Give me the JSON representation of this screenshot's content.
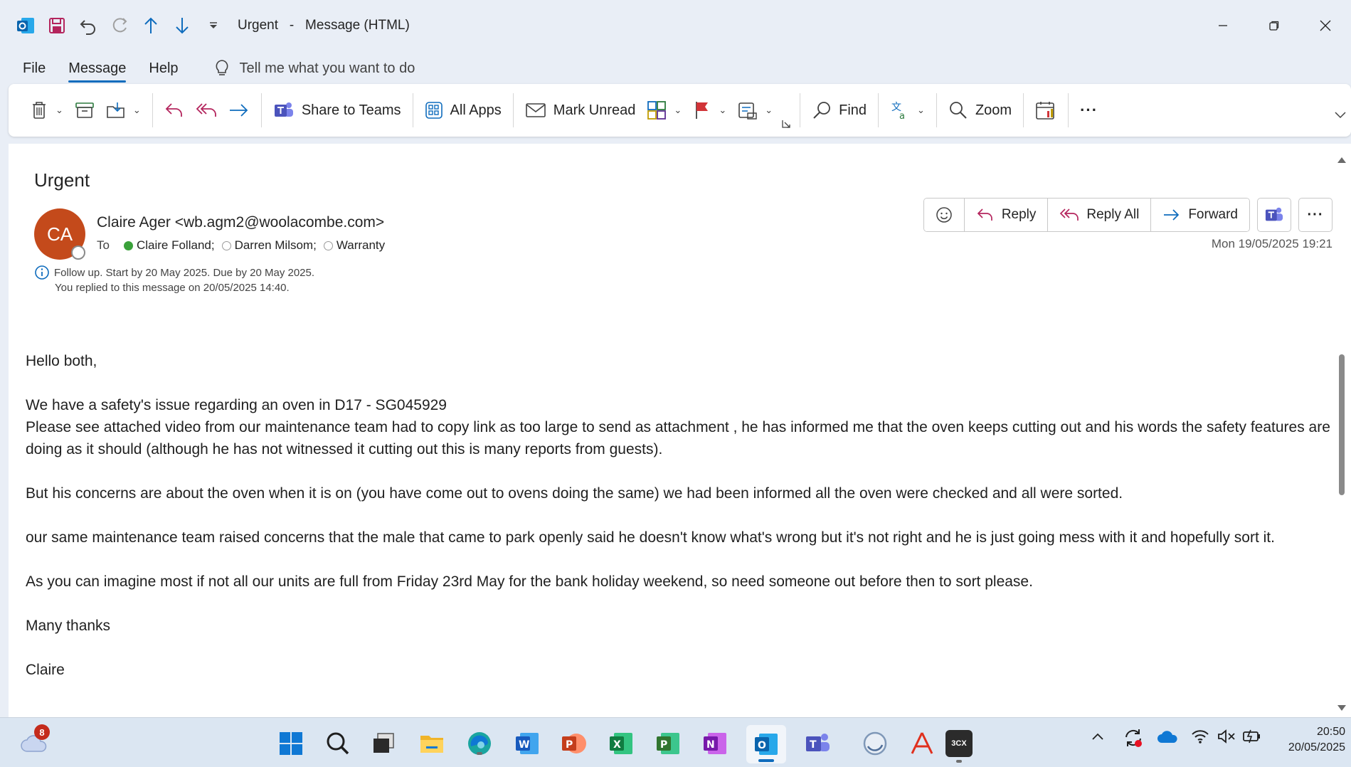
{
  "window": {
    "title_subject": "Urgent",
    "title_separator": "-",
    "title_type": "Message (HTML)"
  },
  "menu": {
    "tabs": [
      "File",
      "Message",
      "Help"
    ],
    "active_tab": "Message",
    "tell_me": "Tell me what you want to do"
  },
  "ribbon": {
    "share_to_teams": "Share to Teams",
    "all_apps": "All Apps",
    "mark_unread": "Mark Unread",
    "find": "Find",
    "zoom": "Zoom",
    "more": "···"
  },
  "message": {
    "subject": "Urgent",
    "avatar_initials": "CA",
    "sender": "Claire Ager <wb.agm2@woolacombe.com>",
    "to_label": "To",
    "recipients": [
      "Claire Folland;",
      "Darren Milsom;",
      "Warranty"
    ],
    "info_line1": "Follow up.  Start by 20 May 2025.  Due by 20 May 2025.",
    "info_line2": "You replied to this message on 20/05/2025 14:40.",
    "date": "Mon 19/05/2025 19:21",
    "actions": {
      "reply": "Reply",
      "reply_all": "Reply All",
      "forward": "Forward",
      "more": "···"
    },
    "body": {
      "greeting": "Hello both,",
      "p1_line1": "We have a safety's issue regarding an oven in D17 - SG045929",
      "p1_line2": "Please see attached video from our maintenance team had to copy link as too large to send as attachment , he has informed me that the oven keeps cutting out and his words the safety features are doing as it should (although he has not witnessed it cutting out this is many reports from guests).",
      "p2": "But his concerns are about the oven when it is on (you have come out to ovens doing the same) we had been informed all the oven were checked and all were sorted.",
      "p3": "our same maintenance team raised concerns that the male that came to park openly said he doesn't know what's wrong but it's not right and he is just going mess with it and hopefully sort it.",
      "p4": "As you can imagine most if not all our units are full from Friday 23rd May for the bank holiday weekend, so need someone out before then to sort please.",
      "signoff": "Many thanks",
      "signature": "Claire"
    }
  },
  "taskbar": {
    "weather_badge": "8",
    "time": "20:50",
    "date": "20/05/2025",
    "labels": {
      "word": "W",
      "powerpoint": "P",
      "excel": "X",
      "project": "P",
      "onenote": "N",
      "outlook": "O",
      "teams": "T",
      "cx": "3CX"
    }
  },
  "colors": {
    "accent": "#0f6cbd",
    "avatar_bg": "#c44a1b",
    "flag_red": "#d13438",
    "presence_green": "#3aa13a"
  }
}
